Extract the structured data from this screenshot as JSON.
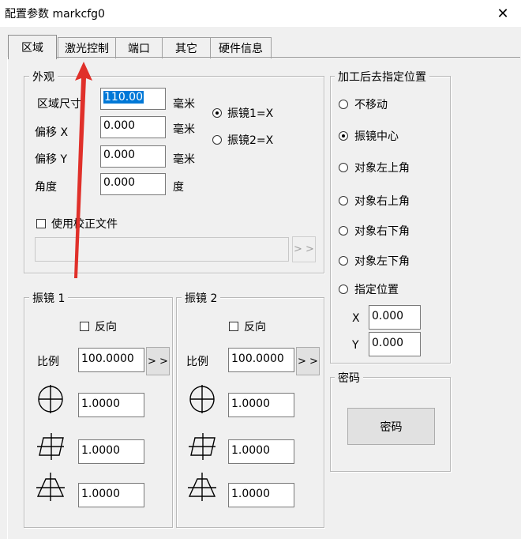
{
  "window": {
    "title": "配置参数 markcfg0",
    "close_glyph": "✕"
  },
  "tabs": [
    "区域",
    "激光控制",
    "端口",
    "其它",
    "硬件信息"
  ],
  "appearance": {
    "legend": "外观",
    "size_label": "区域尺寸",
    "size_value": "110.00",
    "size_unit": "毫米",
    "offset_x_label": "偏移 X",
    "offset_x_value": "0.000",
    "offset_x_unit": "毫米",
    "offset_y_label": "偏移 Y",
    "offset_y_value": "0.000",
    "offset_y_unit": "毫米",
    "angle_label": "角度",
    "angle_value": "0.000",
    "angle_unit": "度",
    "mirror_options": [
      "振镜1=X",
      "振镜2=X"
    ],
    "use_correction_label": "使用校正文件",
    "correction_file_value": "",
    "browse_label": "> >"
  },
  "galvo1": {
    "legend": "振镜 1",
    "reverse_label": "反向",
    "scale_label": "比例",
    "scale_value": "100.0000",
    "scale_button": "> >",
    "param1_value": "1.0000",
    "param2_value": "1.0000",
    "param3_value": "1.0000"
  },
  "galvo2": {
    "legend": "振镜 2",
    "reverse_label": "反向",
    "scale_label": "比例",
    "scale_value": "100.0000",
    "scale_button": "> >",
    "param1_value": "1.0000",
    "param2_value": "1.0000",
    "param3_value": "1.0000"
  },
  "goto_position": {
    "legend": "加工后去指定位置",
    "options": [
      "不移动",
      "振镜中心",
      "对象左上角",
      "对象右上角",
      "对象右下角",
      "对象左下角",
      "指定位置"
    ],
    "selected_index": 1,
    "x_label": "X",
    "x_value": "0.000",
    "y_label": "Y",
    "y_value": "0.000"
  },
  "password": {
    "legend": "密码",
    "button_label": "密码"
  },
  "annotation": {
    "arrow_color": "#e0302a"
  }
}
